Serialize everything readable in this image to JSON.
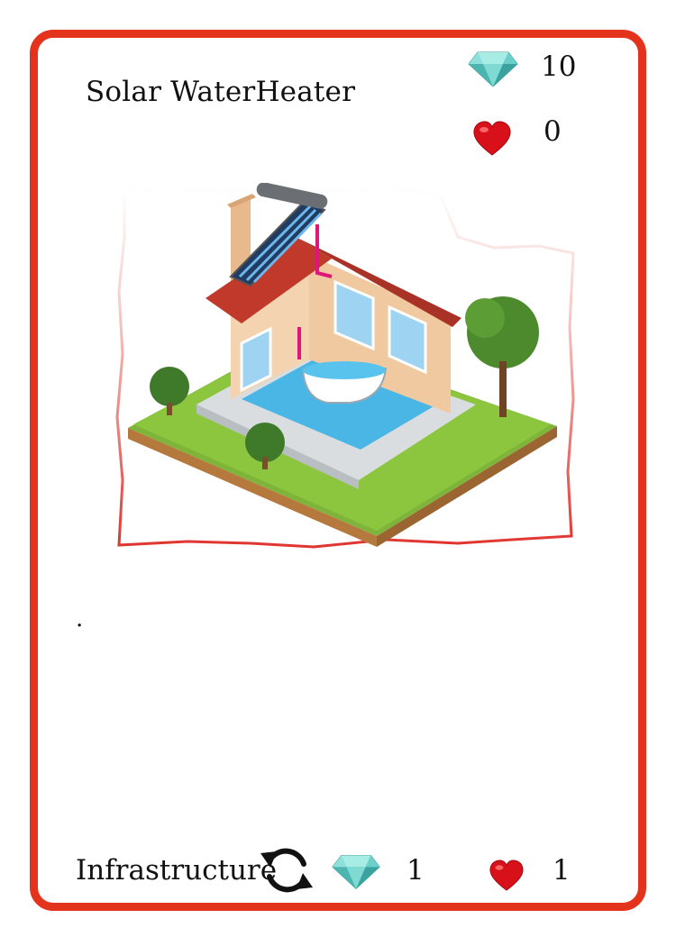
{
  "card": {
    "title": "Solar WaterHeater",
    "cost_gems": "10",
    "cost_hearts": "0",
    "description": ".",
    "type": "Infrastructure",
    "reward_gems": "1",
    "reward_hearts": "1"
  },
  "icons": {
    "gem": "diamond-icon",
    "heart": "heart-icon",
    "cycle": "refresh-cycle-icon"
  },
  "colors": {
    "border": "#e4331c",
    "heart": "#d8101a",
    "gem": "#6fd3cc"
  }
}
